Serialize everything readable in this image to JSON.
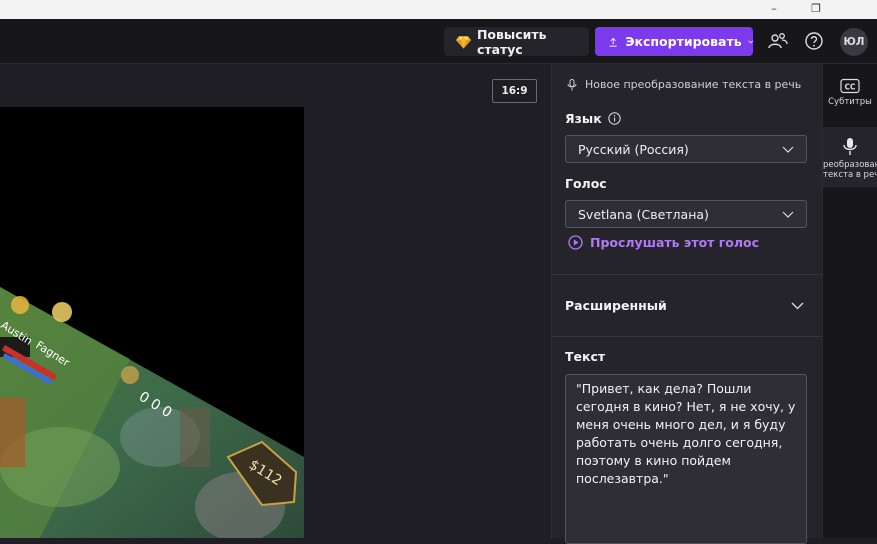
{
  "window": {
    "minimize": "–",
    "restore": "❐"
  },
  "header": {
    "upgrade_label": "Повысить статус",
    "export_label": "Экспортировать",
    "avatar_initials": "ЮЛ",
    "icons": [
      "gem-icon",
      "upload-icon",
      "chevron-down-icon",
      "share-people-icon",
      "help-icon"
    ],
    "accent_color": "#7c3aed"
  },
  "preview": {
    "aspect_ratio": "16:9",
    "game_overlay": {
      "player1": "Austin",
      "player2": "Fagner",
      "score": "0  0  0",
      "gold": "$112"
    }
  },
  "panel": {
    "title": "Новое преобразование текста в речь",
    "language_label": "Язык",
    "language_value": "Русский (Россия)",
    "voice_label": "Голос",
    "voice_value": "Svetlana (Светлана)",
    "listen_link": "Прослушать этот голос",
    "advanced_label": "Расширенный",
    "text_label": "Текст",
    "text_value": "\"Привет, как дела? Пошли сегодня в кино? Нет, я не хочу, у меня очень много дел, и я буду работать очень долго сегодня, поэтому в кино пойдем послезавтра.\"",
    "link_color": "#b07af7"
  },
  "sidebar": {
    "tabs": [
      {
        "label": "Субтитры",
        "icon": "closed-captions-icon",
        "active": false
      },
      {
        "label1": "реобразован",
        "label2": "текста в реч",
        "icon": "microphone-icon",
        "active": true
      }
    ]
  }
}
